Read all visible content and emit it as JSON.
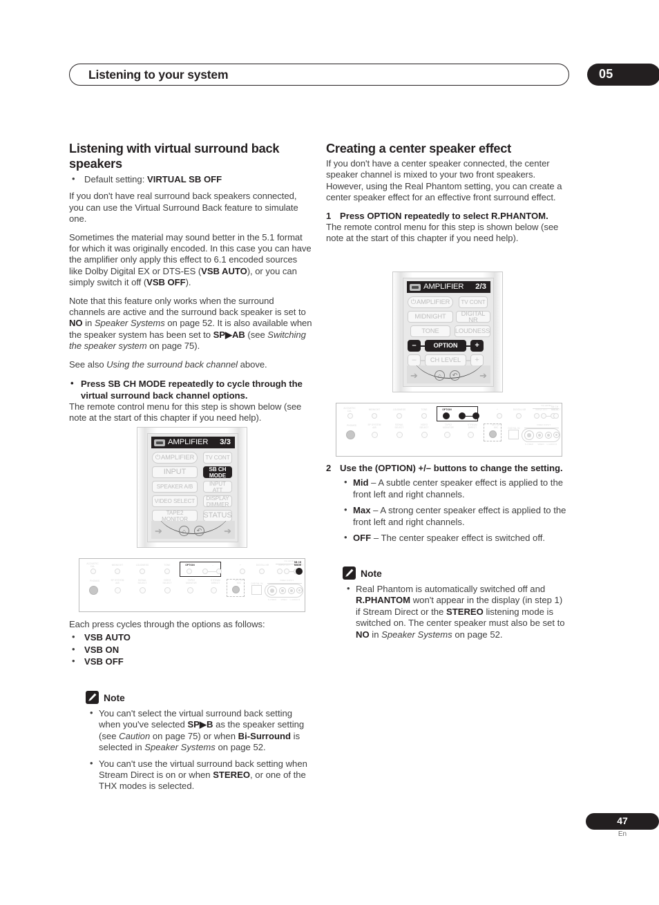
{
  "header": {
    "title": "Listening to your system",
    "chapter": "05"
  },
  "footer": {
    "page_number": "47",
    "language": "En"
  },
  "left_column": {
    "heading": "Listening with virtual surround back speakers",
    "default_setting_bullet": "Default setting: VIRTUAL SB OFF",
    "default_setting_label": "Default setting: ",
    "default_setting_value": "VIRTUAL SB OFF",
    "para1": "If you don't have real surround back speakers connected, you can use the Virtual Surround Back feature to simulate one.",
    "para2_a": "Sometimes the material may sound better in the 5.1 format for which it was originally encoded. In this case you can have the amplifier only apply this effect to 6.1 encoded sources like Dolby Digital EX or DTS-ES (",
    "para2_b": "VSB AUTO",
    "para2_c": "), or you can simply switch it off (",
    "para2_d": "VSB OFF",
    "para2_e": ").",
    "para3_a": "Note that this feature only works when the surround channels are active and the surround back speaker is set to ",
    "para3_b": "NO",
    "para3_c": " in ",
    "para3_d": "Speaker Systems",
    "para3_e": " on page 52. It is also available when the speaker system has been set to ",
    "para3_f": "SP▶AB",
    "para3_g": " (see ",
    "para3_h": "Switching the speaker system",
    "para3_i": " on page 75).",
    "para4_a": "See also ",
    "para4_b": "Using the surround back channel",
    "para4_c": " above.",
    "instruction": "Press SB CH MODE repeatedly to cycle through the virtual surround back channel options.",
    "instruction_follow": "The remote control menu for this step is shown below (see note at the start of this chapter if you need help).",
    "cycle_intro": "Each press cycles through the options as follows:",
    "cycle_options": [
      "VSB AUTO",
      "VSB ON",
      "VSB OFF"
    ],
    "note_label": "Note",
    "note_items": [
      {
        "a": "You can't select the virtual surround back setting when you've selected ",
        "b": "SP▶B",
        "c": " as the speaker setting (see ",
        "d": "Caution",
        "e": " on page 75) or when ",
        "f": "Bi-Surround",
        "g": " is selected in ",
        "h": "Speaker Systems",
        "i": " on page 52."
      },
      {
        "a": "You can't use the virtual surround back setting when Stream Direct is on or when ",
        "b": "STEREO",
        "c": ", or one of the THX modes is selected."
      }
    ],
    "remote": {
      "lcd_title": "AMPLIFIER",
      "lcd_page": "3/3",
      "buttons": [
        {
          "label": "AMPLIFIER",
          "state": "dim"
        },
        {
          "label": "TV CONT",
          "state": "dim"
        },
        {
          "label": "INPUT",
          "state": "dim"
        },
        {
          "label": "SB CH MODE",
          "state": "selected"
        },
        {
          "label": "SPEAKER A/B",
          "state": "dim"
        },
        {
          "label": "INPUT ATT",
          "state": "dim"
        },
        {
          "label": "VIDEO SELECT",
          "state": "dim"
        },
        {
          "label": "DISPLAY DIMMER",
          "state": "dim"
        },
        {
          "label": "TAPE2 MONITOR",
          "state": "dim"
        },
        {
          "label": "STATUS",
          "state": "dim"
        }
      ]
    }
  },
  "right_column": {
    "heading": "Creating a center speaker effect",
    "para1": "If you don't have a center speaker connected, the center speaker channel is mixed to your two front speakers. However, using the Real Phantom setting, you can create a center speaker effect for an effective front surround effect.",
    "step1_num": "1",
    "step1_text": "Press OPTION repeatedly to select R.PHANTOM.",
    "step1_follow": "The remote control menu for this step is shown below (see note at the start of this chapter if you need help).",
    "step2_num": "2",
    "step2_text": "Use the (OPTION) +/– buttons to change the setting.",
    "setting_options": [
      {
        "name": "Mid",
        "desc": " – A subtle center speaker effect is applied to the front left and right channels."
      },
      {
        "name": "Max",
        "desc": " – A strong center speaker effect is applied to the front left and right channels."
      },
      {
        "name": "OFF",
        "desc": " – The center speaker effect is switched off."
      }
    ],
    "note_label": "Note",
    "note_item": {
      "a": "Real Phantom is automatically switched off and ",
      "b": "R.PHANTOM",
      "c": " won't appear in the display (in step 1) if Stream Direct or the ",
      "d": "STEREO",
      "e": " listening mode is switched on. The center speaker must also be set to ",
      "f": "NO",
      "g": " in ",
      "h": "Speaker Systems",
      "i": " on page 52."
    },
    "remote": {
      "lcd_title": "AMPLIFIER",
      "lcd_page": "2/3",
      "buttons": [
        {
          "label": "AMPLIFIER",
          "state": "dim"
        },
        {
          "label": "TV CONT",
          "state": "dim"
        },
        {
          "label": "MIDNIGHT",
          "state": "dim"
        },
        {
          "label": "DIGITAL NR",
          "state": "dim"
        },
        {
          "label": "TONE",
          "state": "dim"
        },
        {
          "label": "LOUDNESS",
          "state": "dim"
        },
        {
          "label": "–",
          "state": "selected"
        },
        {
          "label": "OPTION",
          "state": "selected"
        },
        {
          "label": "+",
          "state": "selected"
        },
        {
          "label": "–",
          "state": "dim"
        },
        {
          "label": "CH LEVEL",
          "state": "dim"
        },
        {
          "label": "+",
          "state": "dim"
        }
      ]
    }
  },
  "front_panel": {
    "row1_labels": [
      "ACOUSTIC CAL",
      "MIDNIGHT",
      "LOUDNESS",
      "TONE",
      "OPTION",
      "–",
      "+",
      "DIGITAL NR",
      "INPUT ATT",
      "SELECT",
      "–",
      "+",
      "SB CH MODE"
    ],
    "ch_level_label": "CH LEVEL",
    "row2_labels": [
      "PHONES",
      "SP SYSTEM A/B",
      "SIGNAL SELECT",
      "VIDEO SELECT",
      "TAPE2 MONITOR",
      "STREAM DIRECT",
      "SET UP MIC",
      "DIGITAL IN"
    ],
    "video_input_label": "VIDEO INPUT",
    "jack_labels": [
      "S-VIDEO",
      "VIDEO",
      "L",
      "AUDIO",
      "R"
    ],
    "left_panel_highlight": "SB CH MODE",
    "right_panel_highlight": "OPTION"
  }
}
